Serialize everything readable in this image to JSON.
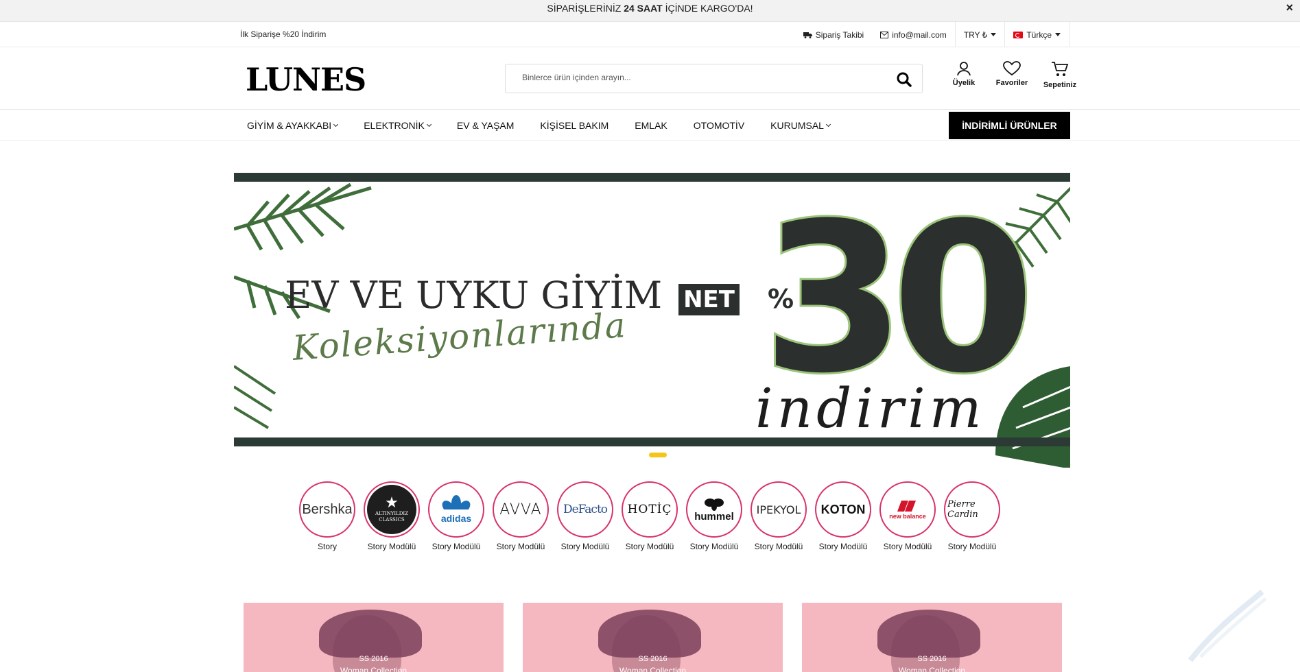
{
  "announce": {
    "before": "SİPARİŞLERİNİZ ",
    "bold": "24 SAAT",
    "after": " İÇİNDE KARGO'DA!",
    "close": "×"
  },
  "topbar": {
    "promo": "İlk Siparişe %20 İndirim",
    "order_tracking": "Sipariş Takibi",
    "email": "info@mail.com",
    "currency": "TRY ₺",
    "language": "Türkçe"
  },
  "header": {
    "logo": "LUNES",
    "search_placeholder": "Binlerce ürün içinden arayın...",
    "membership": "Üyelik",
    "favorites": "Favoriler",
    "cart": "Sepetiniz"
  },
  "nav": {
    "items": [
      {
        "label": "GİYİM & AYAKKABI",
        "dropdown": true
      },
      {
        "label": "ELEKTRONİK",
        "dropdown": true
      },
      {
        "label": "EV & YAŞAM",
        "dropdown": false
      },
      {
        "label": "KİŞİSEL BAKIM",
        "dropdown": false
      },
      {
        "label": "EMLAK",
        "dropdown": false
      },
      {
        "label": "OTOMOTİV",
        "dropdown": false
      },
      {
        "label": "KURUMSAL",
        "dropdown": true
      }
    ],
    "discount_button": "İNDİRİMLİ ÜRÜNLER"
  },
  "hero": {
    "title": "EV VE UYKU GİYİM",
    "script": "Koleksiyonlarında",
    "net": "NET",
    "percent": "%",
    "number": "30",
    "indirim": "indirim",
    "colors": {
      "dark": "#2b2f2d",
      "green": "#9bc47a",
      "dot": "#f5c518"
    }
  },
  "stories": [
    {
      "brand": "Bershka",
      "label": "Story"
    },
    {
      "brand": "ALTINYILDIZ CLASSICS",
      "label": "Story Modülü"
    },
    {
      "brand": "adidas",
      "label": "Story Modülü"
    },
    {
      "brand": "AVVA",
      "label": "Story Modülü"
    },
    {
      "brand": "DeFacto",
      "label": "Story Modülü"
    },
    {
      "brand": "HOTİÇ",
      "label": "Story Modülü"
    },
    {
      "brand": "hummel",
      "label": "Story Modülü"
    },
    {
      "brand": "IPEKYOL",
      "label": "Story Modülü"
    },
    {
      "brand": "KOTON",
      "label": "Story Modülü"
    },
    {
      "brand": "new balance",
      "label": "Story Modülü"
    },
    {
      "brand": "Pierre Cardin",
      "label": "Story Modülü"
    }
  ],
  "tiles": [
    {
      "line1": "SS 2016",
      "line2": "Woman Collection"
    },
    {
      "line1": "SS 2016",
      "line2": "Woman Collection"
    },
    {
      "line1": "SS 2016",
      "line2": "Woman Collection"
    }
  ],
  "colors": {
    "accent_ring": "#d8336a",
    "tile_bg": "#f5b8c0"
  }
}
